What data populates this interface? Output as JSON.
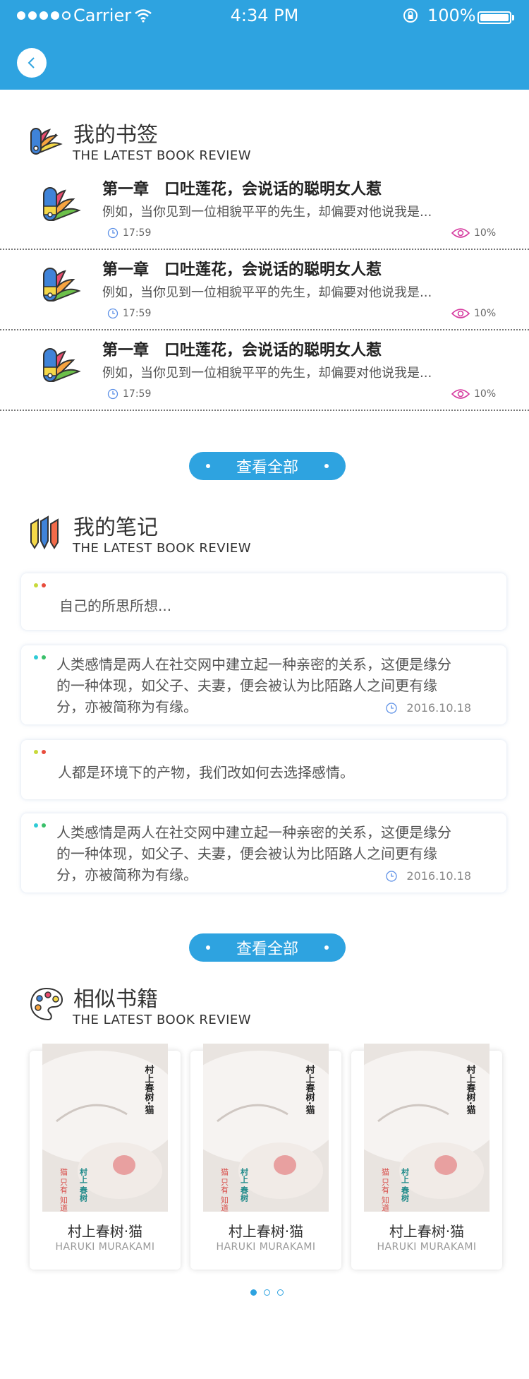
{
  "status_bar": {
    "carrier": "Carrier",
    "time": "4:34 PM",
    "battery": "100%"
  },
  "bookmarks": {
    "title": "我的书签",
    "subtitle": "THE LATEST BOOK REVIEW",
    "items": [
      {
        "title": "第一章　口吐莲花，会说话的聪明女人惹",
        "desc": "例如，当你见到一位相貌平平的先生，却偏要对他说我是...",
        "time": "17:59",
        "views": "10%"
      },
      {
        "title": "第一章　口吐莲花，会说话的聪明女人惹",
        "desc": "例如，当你见到一位相貌平平的先生，却偏要对他说我是...",
        "time": "17:59",
        "views": "10%"
      },
      {
        "title": "第一章　口吐莲花，会说话的聪明女人惹",
        "desc": "例如，当你见到一位相貌平平的先生，却偏要对他说我是...",
        "time": "17:59",
        "views": "10%"
      }
    ],
    "more_label": "查看全部"
  },
  "notes": {
    "title": "我的笔记",
    "subtitle": "THE LATEST BOOK REVIEW",
    "items": [
      {
        "text": "自己的所思所想..."
      },
      {
        "text": "人类感情是两人在社交网中建立起一种亲密的关系，这便是缘分的一种体现，如父子、夫妻，便会被认为比陌路人之间更有缘分，亦被简称为有缘。",
        "date": "2016.10.18"
      },
      {
        "text": "人都是环境下的产物，我们改如何去选择感情。"
      },
      {
        "text": "人类感情是两人在社交网中建立起一种亲密的关系，这便是缘分的一种体现，如父子、夫妻，便会被认为比陌路人之间更有缘分，亦被简称为有缘。",
        "date": "2016.10.18"
      }
    ],
    "more_label": "查看全部"
  },
  "similar": {
    "title": "相似书籍",
    "subtitle": "THE LATEST BOOK REVIEW",
    "books": [
      {
        "title": "村上春树·猫",
        "author": "HARUKI MURAKAMI"
      },
      {
        "title": "村上春树·猫",
        "author": "HARUKI MURAKAMI"
      },
      {
        "title": "村上春树·猫",
        "author": "HARUKI MURAKAMI"
      }
    ],
    "cover_text": {
      "main": "村上春树·猫",
      "red": "猫 只有 知道",
      "teal": "村上 春树"
    }
  },
  "colors": {
    "accent": "#2ea3e0",
    "header": "#2ea3e0"
  }
}
